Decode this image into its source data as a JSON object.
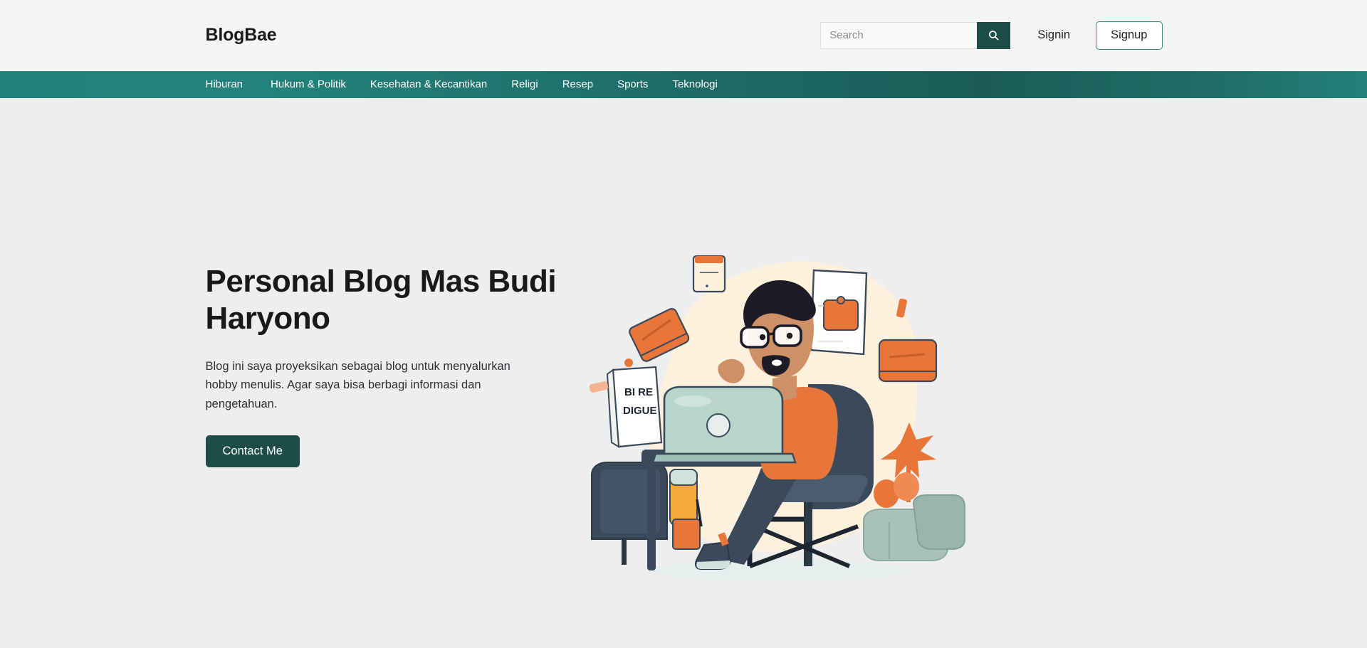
{
  "header": {
    "brand": "BlogBae",
    "search": {
      "placeholder": "Search",
      "value": "",
      "icon": "search-icon",
      "button_label": ""
    },
    "signin_label": "Signin",
    "signup_label": "Signup"
  },
  "nav": {
    "items": [
      {
        "label": "Hiburan"
      },
      {
        "label": "Hukum & Politik"
      },
      {
        "label": "Kesehatan & Kecantikan"
      },
      {
        "label": "Religi"
      },
      {
        "label": "Resep"
      },
      {
        "label": "Sports"
      },
      {
        "label": "Teknologi"
      }
    ]
  },
  "hero": {
    "title": "Personal Blog Mas Budi Haryono",
    "description": "Blog ini saya proyeksikan sebagai blog untuk menyalurkan hobby menulis. Agar saya bisa berbagi informasi dan pengetahuan.",
    "cta_label": "Contact Me",
    "illustration": {
      "name": "man-blogging-at-laptop-illustration",
      "paper_text_line1": "BI RE",
      "paper_text_line2": "DIGUE"
    }
  },
  "colors": {
    "page_background": "#eeeeee",
    "header_background": "#f5f5f5",
    "nav_gradient_start": "#24807a",
    "nav_gradient_end": "#1b5c58",
    "primary_dark": "#1d4d46",
    "accent_orange": "#e8763a",
    "blob_cream": "#fdf0dc",
    "navy": "#3b4a5a",
    "text_dark": "#19191c"
  }
}
